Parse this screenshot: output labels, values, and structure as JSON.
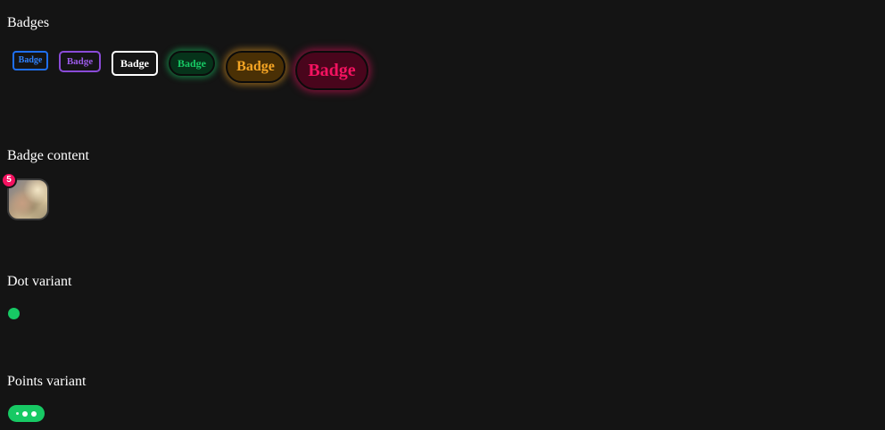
{
  "sections": {
    "badges": {
      "title": "Badges"
    },
    "badge_content": {
      "title": "Badge content"
    },
    "dot_variant": {
      "title": "Dot variant"
    },
    "points_variant": {
      "title": "Points variant"
    }
  },
  "badges": [
    {
      "label": "Badge",
      "color": "#2f82ff",
      "variant": "bordered",
      "size": "xs"
    },
    {
      "label": "Badge",
      "color": "#9b5be8",
      "variant": "bordered",
      "size": "sm"
    },
    {
      "label": "Badge",
      "color": "#ffffff",
      "variant": "bordered",
      "size": "md"
    },
    {
      "label": "Badge",
      "color": "#17c964",
      "variant": "shadow",
      "size": "md"
    },
    {
      "label": "Badge",
      "color": "#f5a524",
      "variant": "shadow",
      "size": "lg"
    },
    {
      "label": "Badge",
      "color": "#f31260",
      "variant": "shadow",
      "size": "xl"
    }
  ],
  "badge_content": {
    "count": "5",
    "count_color": "#f31260",
    "avatar_icon": "avatar-photo"
  },
  "dot_variant": {
    "color": "#17c964"
  },
  "points_variant": {
    "color": "#17c964",
    "points": 3
  }
}
